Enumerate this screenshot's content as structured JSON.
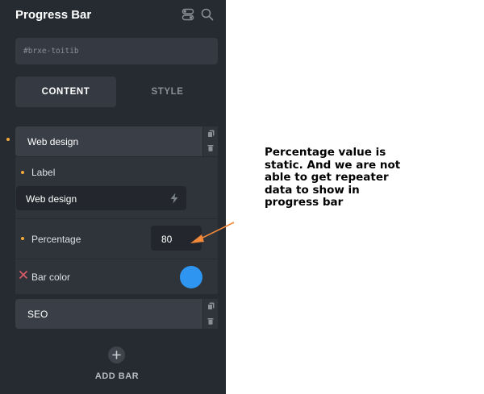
{
  "panel": {
    "title": "Progress Bar",
    "css_id": "#brxe-toitib",
    "tabs": [
      {
        "label": "CONTENT",
        "active": true
      },
      {
        "label": "STYLE",
        "active": false
      }
    ],
    "items": [
      {
        "title": "Web design",
        "expanded": true,
        "fields": {
          "label": {
            "name": "Label",
            "value": "Web design"
          },
          "percentage": {
            "name": "Percentage",
            "value": "80"
          },
          "bar_color": {
            "name": "Bar color",
            "value": "#2e95f0"
          }
        }
      },
      {
        "title": "SEO",
        "expanded": false
      }
    ],
    "add_button_label": "ADD BAR",
    "icons": {
      "header": [
        "toggle-icon",
        "search-icon"
      ],
      "item_actions": [
        "duplicate-icon",
        "delete-icon"
      ],
      "input": "bolt-icon",
      "add": "plus-icon",
      "reset": "x-icon"
    }
  },
  "annotation": {
    "lines": [
      "Percentage value is",
      "static. And we are not",
      "able to get repeater",
      "data to show in",
      "progress bar"
    ],
    "arrow_color": "#f2893a"
  },
  "colors": {
    "panel_bg": "#262a31",
    "accent_dot": "#f3a93b",
    "reset_x": "#e05b6a"
  }
}
